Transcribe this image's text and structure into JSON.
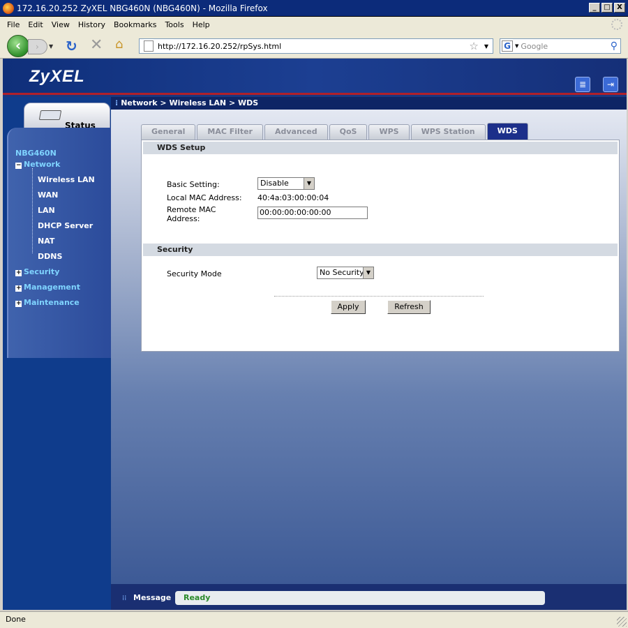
{
  "window": {
    "title": "172.16.20.252 ZyXEL NBG460N (NBG460N) - Mozilla Firefox",
    "minimize": "_",
    "maximize": "□",
    "close": "X"
  },
  "menubar": [
    "File",
    "Edit",
    "View",
    "History",
    "Bookmarks",
    "Tools",
    "Help"
  ],
  "navbar": {
    "url": "http://172.16.20.252/rpSys.html",
    "search_placeholder": "Google"
  },
  "app": {
    "logo": "ZyXEL",
    "breadcrumb": "Network > Wireless LAN > WDS",
    "status_tab": "Status",
    "device": "NBG460N"
  },
  "sidebar": {
    "network": "Network",
    "sub_items": [
      "Wireless LAN",
      "WAN",
      "LAN",
      "DHCP Server",
      "NAT",
      "DDNS"
    ],
    "security": "Security",
    "management": "Management",
    "maintenance": "Maintenance"
  },
  "tabs": [
    "General",
    "MAC Filter",
    "Advanced",
    "QoS",
    "WPS",
    "WPS Station",
    "WDS"
  ],
  "active_tab": "WDS",
  "wds_setup": {
    "heading": "WDS Setup",
    "basic_setting_label": "Basic Setting:",
    "basic_setting_value": "Disable",
    "local_mac_label": "Local MAC Address:",
    "local_mac_value": "40:4a:03:00:00:04",
    "remote_mac_label_1": "Remote MAC",
    "remote_mac_label_2": "Address:",
    "remote_mac_value": "00:00:00:00:00:00"
  },
  "security": {
    "heading": "Security",
    "mode_label": "Security Mode",
    "mode_value": "No Security"
  },
  "buttons": {
    "apply": "Apply",
    "refresh": "Refresh"
  },
  "message": {
    "label": "Message",
    "value": "Ready"
  },
  "statusbar": {
    "text": "Done"
  }
}
